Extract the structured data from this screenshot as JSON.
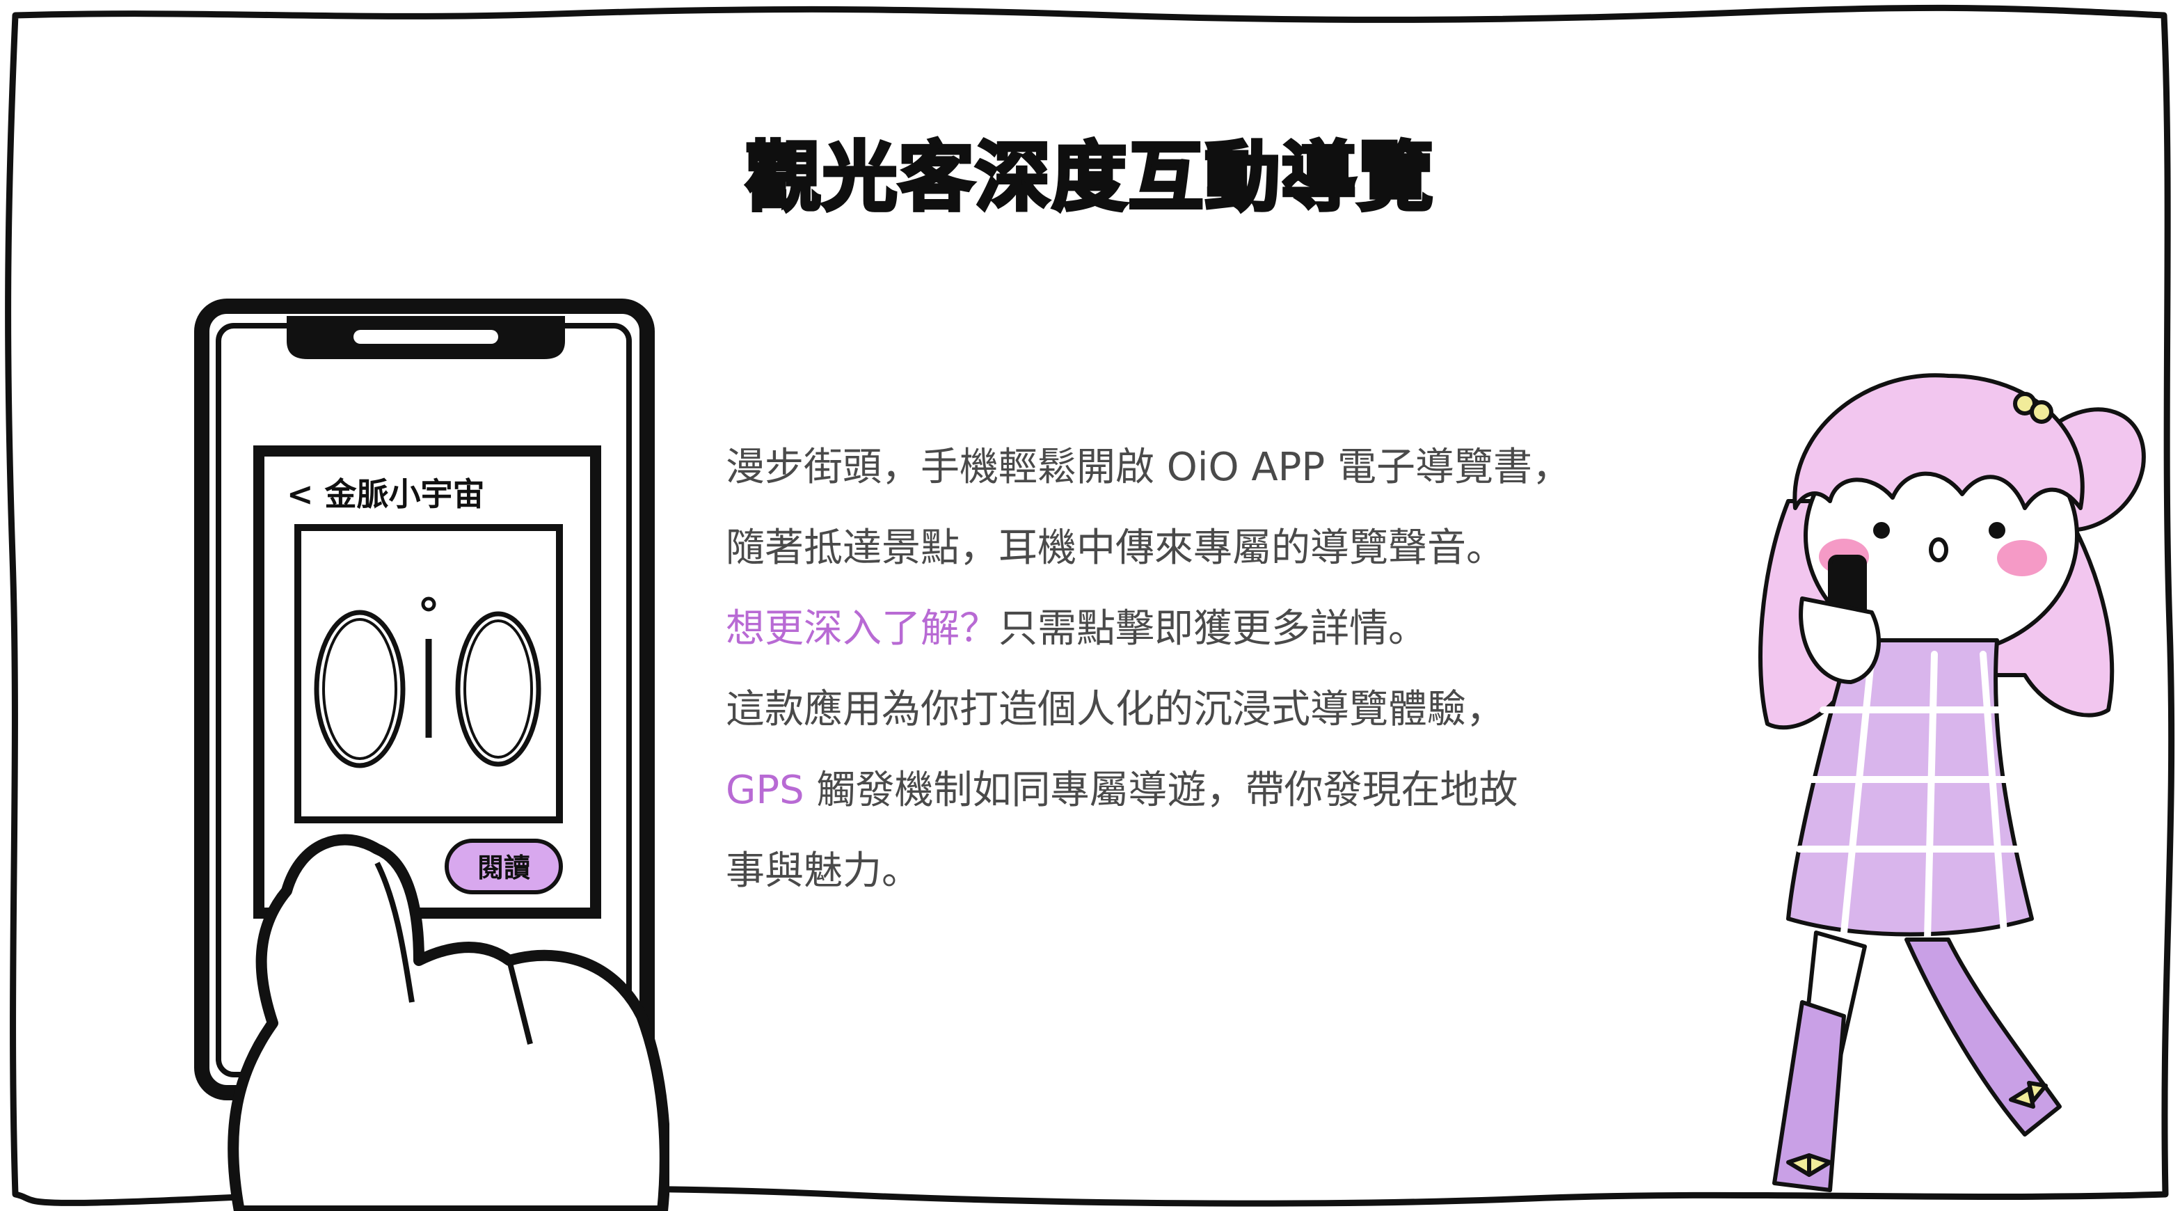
{
  "title": "觀光客深度互動導覽",
  "phone_screen": {
    "header_label": "< 金脈小宇宙",
    "logo_text": "OiO",
    "read_button": "閱讀"
  },
  "body": {
    "line1": "漫步街頭，手機輕鬆開啟 OiO APP 電子導覽書，",
    "line2": "隨著抵達景點，耳機中傳來專屬的導覽聲音。",
    "line3_accent": "想更深入了解？",
    "line3_rest": "只需點擊即獲更多詳情。",
    "line4": "這款應用為你打造個人化的沉浸式導覽體驗，",
    "line5_accent": "GPS",
    "line5_rest": " 觸發機制如同專屬導遊，帶你發現在地故",
    "line6": "事與魅力。"
  },
  "colors": {
    "accent": "#b86ad4",
    "text": "#4a4a4a",
    "title": "#0f0f0f",
    "hair": "#f2c6ef",
    "dress": "#d9b5ec",
    "socks": "#c9a0e6",
    "button": "#d8a8ee"
  },
  "icons": [
    "phone-illustration",
    "pointing-hand",
    "girl-character"
  ]
}
